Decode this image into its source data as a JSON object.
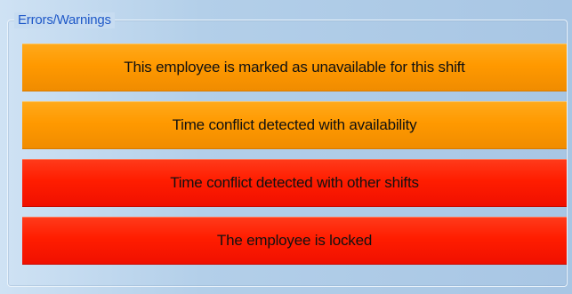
{
  "groupbox": {
    "title": "Errors/Warnings"
  },
  "messages": [
    {
      "text": "This employee is marked as unavailable for this shift",
      "severity": "warning",
      "color": "#ff9900"
    },
    {
      "text": "Time conflict detected with availability",
      "severity": "warning",
      "color": "#ff9900"
    },
    {
      "text": "Time conflict detected with other shifts",
      "severity": "error",
      "color": "#ff1d00"
    },
    {
      "text": "The employee is locked",
      "severity": "error",
      "color": "#ff1d00"
    }
  ]
}
